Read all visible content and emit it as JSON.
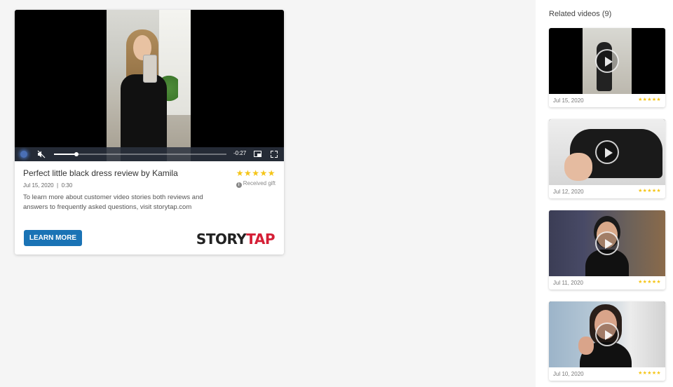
{
  "player": {
    "time_remaining": "-0:27",
    "progress": 0.13
  },
  "video": {
    "title": "Perfect little black dress review by Kamila",
    "date": "Jul 15, 2020",
    "separator": "|",
    "duration": "0:30",
    "stars": "★★★★★",
    "gift_label": "Received gift",
    "description": "To learn more about customer video stories both reviews and answers to frequently asked questions, visit storytap.com",
    "learn_more_label": "LEARN MORE"
  },
  "brand": {
    "logo_part1": "STORY",
    "logo_part2": "TAP",
    "accent_color": "#1a73b5",
    "logo_red": "#d51f36"
  },
  "sidebar": {
    "title": "Related videos (9)",
    "items": [
      {
        "date": "Jul 15, 2020",
        "stars": "★★★★★"
      },
      {
        "date": "Jul 12, 2020",
        "stars": "★★★★★"
      },
      {
        "date": "Jul 11, 2020",
        "stars": "★★★★★"
      },
      {
        "date": "Jul 10, 2020",
        "stars": "★★★★★"
      }
    ]
  },
  "icons": [
    "play-icon",
    "mute-icon",
    "picture-in-picture-icon",
    "fullscreen-icon",
    "info-icon",
    "play-overlay-icon"
  ]
}
